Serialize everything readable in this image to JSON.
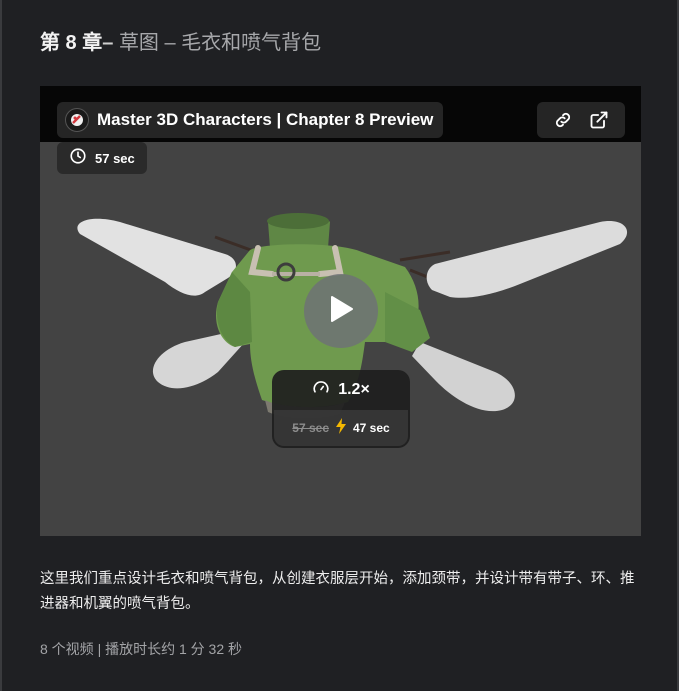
{
  "heading": {
    "chapter": "第 8 章",
    "dash": "– ",
    "subtitle": "草图 – 毛衣和喷气背包"
  },
  "video": {
    "title": "Master 3D Characters | Chapter 8 Preview",
    "duration": "57 sec",
    "speed_label": "1.2×",
    "original_time": "57 sec",
    "new_time": "47 sec",
    "icons": {
      "logo": "brand-logo-icon",
      "link": "link-icon",
      "open_external": "external-link-icon",
      "clock": "clock-icon",
      "play": "play-icon",
      "gauge": "speedometer-icon",
      "lightning": "lightning-icon"
    }
  },
  "description": "这里我们重点设计毛衣和喷气背包，从创建衣服层开始，添加颈带，并设计带有带子、环、推进器和机翼的喷气背包。",
  "meta": "8 个视频 | 播放时长约 1 分 32 秒",
  "colors": {
    "page_bg": "#1f2023",
    "scene_bg": "#434343",
    "sweater": "#6f9a4e",
    "wings": "#dcdcdc",
    "lightning": "#f5b800"
  }
}
